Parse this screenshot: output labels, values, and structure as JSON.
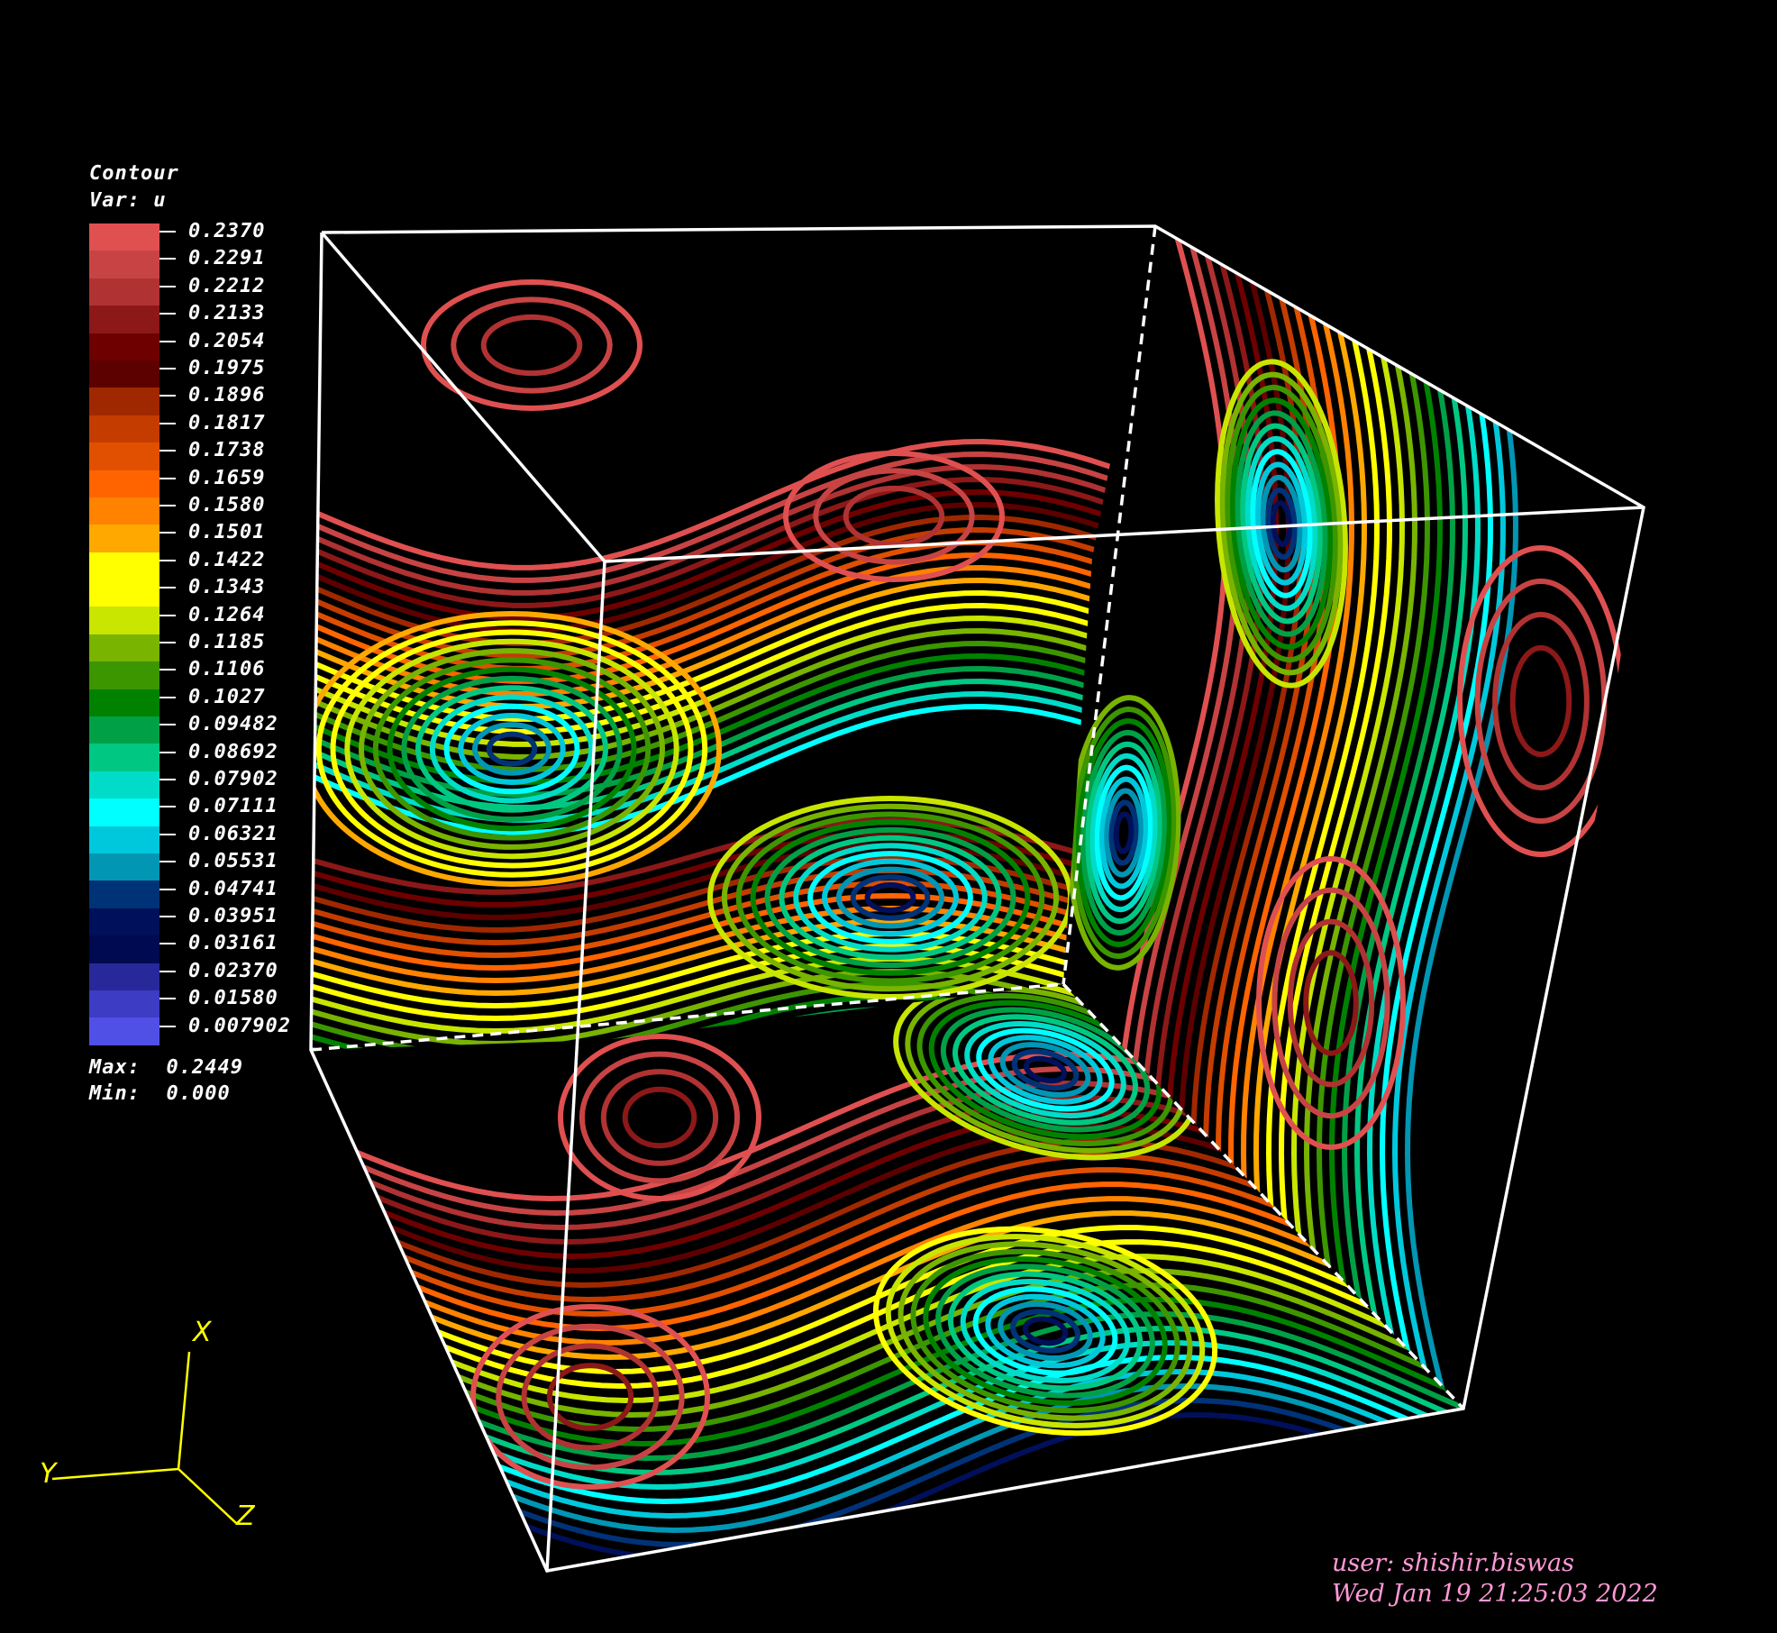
{
  "legend": {
    "title": "Contour",
    "variable": "Var: u",
    "levels": [
      {
        "value": "0.2370",
        "color": "#e05050"
      },
      {
        "value": "0.2291",
        "color": "#c84444"
      },
      {
        "value": "0.2212",
        "color": "#b03232"
      },
      {
        "value": "0.2133",
        "color": "#8c1818"
      },
      {
        "value": "0.2054",
        "color": "#6e0000"
      },
      {
        "value": "0.1975",
        "color": "#5c0000"
      },
      {
        "value": "0.1896",
        "color": "#a02800"
      },
      {
        "value": "0.1817",
        "color": "#c43c00"
      },
      {
        "value": "0.1738",
        "color": "#e05000"
      },
      {
        "value": "0.1659",
        "color": "#ff6400"
      },
      {
        "value": "0.1580",
        "color": "#ff8200"
      },
      {
        "value": "0.1501",
        "color": "#ffa800"
      },
      {
        "value": "0.1422",
        "color": "#ffff00"
      },
      {
        "value": "0.1343",
        "color": "#ffff00"
      },
      {
        "value": "0.1264",
        "color": "#c8e600"
      },
      {
        "value": "0.1185",
        "color": "#78b400"
      },
      {
        "value": "0.1106",
        "color": "#3c9600"
      },
      {
        "value": "0.1027",
        "color": "#008200"
      },
      {
        "value": "0.09482",
        "color": "#00a046"
      },
      {
        "value": "0.08692",
        "color": "#00c882"
      },
      {
        "value": "0.07902",
        "color": "#00dcc8"
      },
      {
        "value": "0.07111",
        "color": "#00ffff"
      },
      {
        "value": "0.06321",
        "color": "#00c8dc"
      },
      {
        "value": "0.05531",
        "color": "#0096b4"
      },
      {
        "value": "0.04741",
        "color": "#003278"
      },
      {
        "value": "0.03951",
        "color": "#00105a"
      },
      {
        "value": "0.03161",
        "color": "#000a50"
      },
      {
        "value": "0.02370",
        "color": "#28289a"
      },
      {
        "value": "0.01580",
        "color": "#3c3cc4"
      },
      {
        "value": "0.007902",
        "color": "#5050e6"
      }
    ],
    "max_label": "Max:",
    "max_value": "0.2449",
    "min_label": "Min:",
    "min_value": "0.000"
  },
  "axes": {
    "x": "X",
    "y": "Y",
    "z": "Z",
    "color": "#ffff00"
  },
  "footer": {
    "user": "user: shishir.biswas",
    "timestamp": "Wed Jan 19 21:25:03 2022"
  },
  "scene": {
    "type": "3D contour plot of variable u on cube faces",
    "background": "#000000",
    "frame_color": "#ffffff"
  }
}
